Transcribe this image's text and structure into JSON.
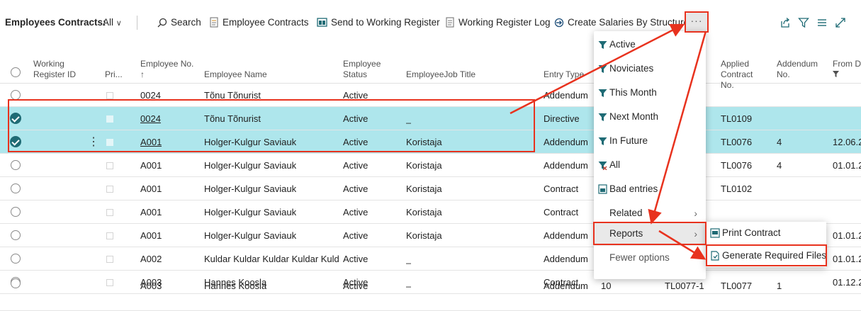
{
  "toolbar": {
    "page_caption": "Employees Contracts:",
    "filter_label": "All",
    "search_label": "Search",
    "employee_contracts_label": "Employee Contracts",
    "send_label": "Send to Working Register",
    "log_label": "Working Register Log",
    "create_label": "Create Salaries By Structure",
    "more_label": "···"
  },
  "columns": {
    "working_register_id": "Working Register ID",
    "pri": "Pri...",
    "employee_no": "Employee No.",
    "employee_no_sort": "↑",
    "employee_name": "Employee Name",
    "employee_status": "Employee Status",
    "job_title": "EmployeeJob Title",
    "entry_type": "Entry Type",
    "applied_contract_no": "Applied Contract No.",
    "addendum_no": "Addendum No.",
    "from_date": "From D"
  },
  "rows": [
    {
      "emp_no": "0024",
      "name": "Tõnu Tõnurist",
      "status": "Active",
      "job": "",
      "entry": "Addendum",
      "extra": "",
      "extra2": "",
      "applied": "",
      "addendum": "",
      "from": ""
    },
    {
      "emp_no": "0024",
      "name": "Tõnu Tõnurist",
      "status": "Active",
      "job": "_",
      "entry": "Directive",
      "extra": "",
      "extra2": "",
      "applied": "TL0109",
      "addendum": "",
      "from": ""
    },
    {
      "emp_no": "A001",
      "name": "Holger-Kulgur Saviauk",
      "status": "Active",
      "job": "Koristaja",
      "entry": "Addendum",
      "extra": "",
      "extra2": "",
      "applied": "TL0076",
      "addendum": "4",
      "from": "12.06.2"
    },
    {
      "emp_no": "A001",
      "name": "Holger-Kulgur Saviauk",
      "status": "Active",
      "job": "Koristaja",
      "entry": "Addendum",
      "extra": "",
      "extra2": "",
      "applied": "TL0076",
      "addendum": "4",
      "from": "01.01.2"
    },
    {
      "emp_no": "A001",
      "name": "Holger-Kulgur Saviauk",
      "status": "Active",
      "job": "Koristaja",
      "entry": "Contract",
      "extra": "",
      "extra2": "",
      "applied": "TL0102",
      "addendum": "",
      "from": ""
    },
    {
      "emp_no": "A001",
      "name": "Holger-Kulgur Saviauk",
      "status": "Active",
      "job": "Koristaja",
      "entry": "Contract",
      "extra": "",
      "extra2": "",
      "applied": "",
      "addendum": "",
      "from": ""
    },
    {
      "emp_no": "A001",
      "name": "Holger-Kulgur Saviauk",
      "status": "Active",
      "job": "Koristaja",
      "entry": "Addendum",
      "extra": "",
      "extra2": "",
      "applied": "",
      "addendum": "",
      "from": "01.01.2"
    },
    {
      "emp_no": "A002",
      "name": "Kuldar Kuldar Kuldar Kuldar Kuld...",
      "status": "Active",
      "job": "_",
      "entry": "Addendum",
      "extra": "",
      "extra2": "",
      "applied": "",
      "addendum": "",
      "from": "01.01.2"
    },
    {
      "emp_no": "A003",
      "name": "Hannes Koosla",
      "status": "Active",
      "job": "_",
      "entry": "Contract",
      "extra": "",
      "extra2": "",
      "applied": "",
      "addendum": "",
      "from": "01.12.2"
    },
    {
      "emp_no": "A003",
      "name": "Hannes Koosla",
      "status": "Active",
      "job": "",
      "entry": "Addendum",
      "extra": "10",
      "extra2": "TL0077-1",
      "applied": "TL0077",
      "addendum": "1",
      "from": ""
    }
  ],
  "menu": {
    "active": "Active",
    "noviciates": "Noviciates",
    "this_month": "This Month",
    "next_month": "Next Month",
    "in_future": "In Future",
    "all": "All",
    "bad_entries": "Bad entries",
    "related": "Related",
    "reports": "Reports",
    "fewer_options": "Fewer options"
  },
  "submenu": {
    "print_contract": "Print Contract",
    "generate_files": "Generate Required Files"
  },
  "colors": {
    "selected_row": "#aee6ec",
    "accent": "#1f6b75",
    "annotation": "#e8321e"
  }
}
